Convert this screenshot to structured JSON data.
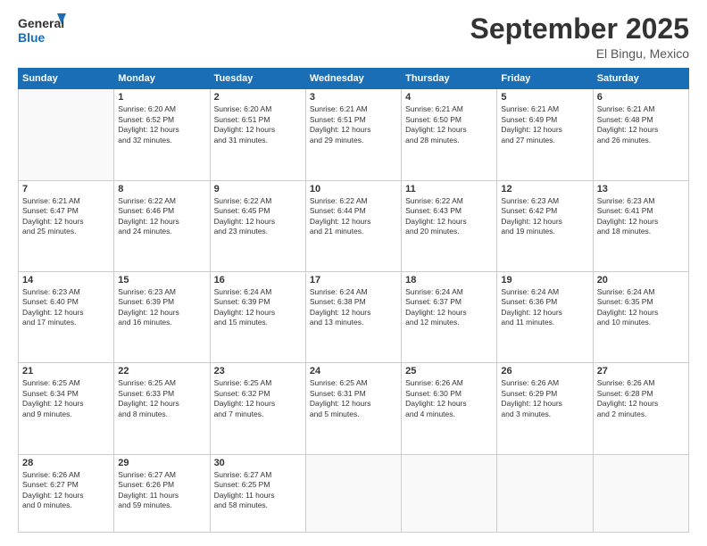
{
  "header": {
    "logo_line1": "General",
    "logo_line2": "Blue",
    "month": "September 2025",
    "location": "El Bingu, Mexico"
  },
  "weekdays": [
    "Sunday",
    "Monday",
    "Tuesday",
    "Wednesday",
    "Thursday",
    "Friday",
    "Saturday"
  ],
  "weeks": [
    [
      {
        "day": "",
        "info": ""
      },
      {
        "day": "1",
        "info": "Sunrise: 6:20 AM\nSunset: 6:52 PM\nDaylight: 12 hours\nand 32 minutes."
      },
      {
        "day": "2",
        "info": "Sunrise: 6:20 AM\nSunset: 6:51 PM\nDaylight: 12 hours\nand 31 minutes."
      },
      {
        "day": "3",
        "info": "Sunrise: 6:21 AM\nSunset: 6:51 PM\nDaylight: 12 hours\nand 29 minutes."
      },
      {
        "day": "4",
        "info": "Sunrise: 6:21 AM\nSunset: 6:50 PM\nDaylight: 12 hours\nand 28 minutes."
      },
      {
        "day": "5",
        "info": "Sunrise: 6:21 AM\nSunset: 6:49 PM\nDaylight: 12 hours\nand 27 minutes."
      },
      {
        "day": "6",
        "info": "Sunrise: 6:21 AM\nSunset: 6:48 PM\nDaylight: 12 hours\nand 26 minutes."
      }
    ],
    [
      {
        "day": "7",
        "info": "Sunrise: 6:21 AM\nSunset: 6:47 PM\nDaylight: 12 hours\nand 25 minutes."
      },
      {
        "day": "8",
        "info": "Sunrise: 6:22 AM\nSunset: 6:46 PM\nDaylight: 12 hours\nand 24 minutes."
      },
      {
        "day": "9",
        "info": "Sunrise: 6:22 AM\nSunset: 6:45 PM\nDaylight: 12 hours\nand 23 minutes."
      },
      {
        "day": "10",
        "info": "Sunrise: 6:22 AM\nSunset: 6:44 PM\nDaylight: 12 hours\nand 21 minutes."
      },
      {
        "day": "11",
        "info": "Sunrise: 6:22 AM\nSunset: 6:43 PM\nDaylight: 12 hours\nand 20 minutes."
      },
      {
        "day": "12",
        "info": "Sunrise: 6:23 AM\nSunset: 6:42 PM\nDaylight: 12 hours\nand 19 minutes."
      },
      {
        "day": "13",
        "info": "Sunrise: 6:23 AM\nSunset: 6:41 PM\nDaylight: 12 hours\nand 18 minutes."
      }
    ],
    [
      {
        "day": "14",
        "info": "Sunrise: 6:23 AM\nSunset: 6:40 PM\nDaylight: 12 hours\nand 17 minutes."
      },
      {
        "day": "15",
        "info": "Sunrise: 6:23 AM\nSunset: 6:39 PM\nDaylight: 12 hours\nand 16 minutes."
      },
      {
        "day": "16",
        "info": "Sunrise: 6:24 AM\nSunset: 6:39 PM\nDaylight: 12 hours\nand 15 minutes."
      },
      {
        "day": "17",
        "info": "Sunrise: 6:24 AM\nSunset: 6:38 PM\nDaylight: 12 hours\nand 13 minutes."
      },
      {
        "day": "18",
        "info": "Sunrise: 6:24 AM\nSunset: 6:37 PM\nDaylight: 12 hours\nand 12 minutes."
      },
      {
        "day": "19",
        "info": "Sunrise: 6:24 AM\nSunset: 6:36 PM\nDaylight: 12 hours\nand 11 minutes."
      },
      {
        "day": "20",
        "info": "Sunrise: 6:24 AM\nSunset: 6:35 PM\nDaylight: 12 hours\nand 10 minutes."
      }
    ],
    [
      {
        "day": "21",
        "info": "Sunrise: 6:25 AM\nSunset: 6:34 PM\nDaylight: 12 hours\nand 9 minutes."
      },
      {
        "day": "22",
        "info": "Sunrise: 6:25 AM\nSunset: 6:33 PM\nDaylight: 12 hours\nand 8 minutes."
      },
      {
        "day": "23",
        "info": "Sunrise: 6:25 AM\nSunset: 6:32 PM\nDaylight: 12 hours\nand 7 minutes."
      },
      {
        "day": "24",
        "info": "Sunrise: 6:25 AM\nSunset: 6:31 PM\nDaylight: 12 hours\nand 5 minutes."
      },
      {
        "day": "25",
        "info": "Sunrise: 6:26 AM\nSunset: 6:30 PM\nDaylight: 12 hours\nand 4 minutes."
      },
      {
        "day": "26",
        "info": "Sunrise: 6:26 AM\nSunset: 6:29 PM\nDaylight: 12 hours\nand 3 minutes."
      },
      {
        "day": "27",
        "info": "Sunrise: 6:26 AM\nSunset: 6:28 PM\nDaylight: 12 hours\nand 2 minutes."
      }
    ],
    [
      {
        "day": "28",
        "info": "Sunrise: 6:26 AM\nSunset: 6:27 PM\nDaylight: 12 hours\nand 0 minutes."
      },
      {
        "day": "29",
        "info": "Sunrise: 6:27 AM\nSunset: 6:26 PM\nDaylight: 11 hours\nand 59 minutes."
      },
      {
        "day": "30",
        "info": "Sunrise: 6:27 AM\nSunset: 6:25 PM\nDaylight: 11 hours\nand 58 minutes."
      },
      {
        "day": "",
        "info": ""
      },
      {
        "day": "",
        "info": ""
      },
      {
        "day": "",
        "info": ""
      },
      {
        "day": "",
        "info": ""
      }
    ]
  ]
}
